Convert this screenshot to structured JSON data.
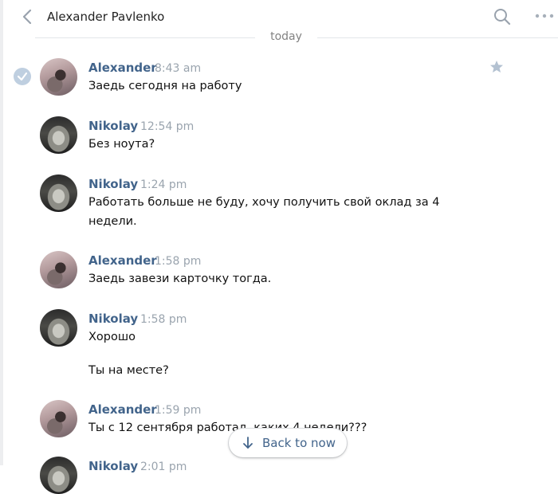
{
  "header": {
    "title": "Alexander Pavlenko",
    "back_icon": "chevron-left-icon",
    "search_icon": "search-icon",
    "more_icon": "more-icon"
  },
  "date_divider": "today",
  "messages": [
    {
      "author": "Alexander",
      "time": "8:43 am",
      "lines": [
        "Заедь сегодня на работу"
      ],
      "selected": true,
      "starred": true
    },
    {
      "author": "Nikolay",
      "time": "12:54 pm",
      "lines": [
        "Без ноута?"
      ]
    },
    {
      "author": "Nikolay",
      "time": "1:24 pm",
      "lines": [
        "Работать больше не буду, хочу получить свой оклад за 4",
        "недели."
      ]
    },
    {
      "author": "Alexander",
      "time": "1:58 pm",
      "lines": [
        "Заедь завези карточку тогда."
      ]
    },
    {
      "author": "Nikolay",
      "time": "1:58 pm",
      "lines": [
        "Хорошо",
        "",
        "Ты на месте?"
      ]
    },
    {
      "author": "Alexander",
      "time": "1:59 pm",
      "lines": [
        "Ты с 12 сентября работал, каких 4 недели???"
      ]
    },
    {
      "author": "Nikolay",
      "time": "2:01 pm",
      "lines": []
    }
  ],
  "back_to_now": "Back to now",
  "colors": {
    "accent": "#42648b",
    "muted": "#9aa4ae",
    "divider": "#e3e6ea"
  }
}
